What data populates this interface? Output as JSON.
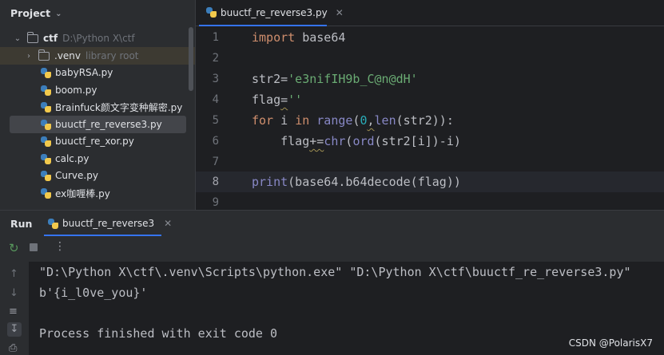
{
  "project_panel": {
    "title": "Project",
    "tree": [
      {
        "name": "ctf",
        "sub": "D:\\Python X\\ctf",
        "type": "folder"
      },
      {
        "name": ".venv",
        "sub": "library root",
        "type": "folder"
      },
      {
        "name": "babyRSA.py",
        "type": "py"
      },
      {
        "name": "boom.py",
        "type": "py"
      },
      {
        "name": "Brainfuck颜文字变种解密.py",
        "type": "py"
      },
      {
        "name": "buuctf_re_reverse3.py",
        "type": "py",
        "selected": true
      },
      {
        "name": "buuctf_re_xor.py",
        "type": "py"
      },
      {
        "name": "calc.py",
        "type": "py"
      },
      {
        "name": "Curve.py",
        "type": "py"
      },
      {
        "name": "ex咖喱棒.py",
        "type": "py"
      }
    ]
  },
  "editor": {
    "tab_label": "buuctf_re_reverse3.py",
    "line_numbers": [
      "1",
      "2",
      "3",
      "4",
      "5",
      "6",
      "7",
      "8",
      "9"
    ],
    "code": {
      "l1_kw": "import",
      "l1_rest": " base64",
      "l3_var": "str2=",
      "l3_str": "'e3nifIH9b_C@n@dH'",
      "l4_var": "flag",
      "l4_eq": "=",
      "l4_str": "''",
      "l5_for": "for",
      "l5_i": " i ",
      "l5_in": "in",
      "l5_sp": " ",
      "l5_range": "range",
      "l5_open": "(",
      "l5_zero": "0",
      "l5_comma": ",",
      "l5_len": "len",
      "l5_rest": "(str2)):",
      "l6_a": "    flag",
      "l6_op": "+=",
      "l6_chr": "chr",
      "l6_b": "(",
      "l6_ord": "ord",
      "l6_c": "(str2[i])-i)",
      "l8_print": "print",
      "l8_rest": "(base64.b64decode(flag))"
    }
  },
  "run_panel": {
    "title": "Run",
    "tab_label": "buuctf_re_reverse3",
    "console": [
      "\"D:\\Python X\\ctf\\.venv\\Scripts\\python.exe\" \"D:\\Python X\\ctf\\buuctf_re_reverse3.py\"",
      "b'{i_l0ve_you}'",
      "",
      "Process finished with exit code 0"
    ]
  },
  "watermark": "CSDN @PolarisX7",
  "colors": {
    "keyword": "#cf8e6d",
    "string": "#6aab73",
    "number": "#2aacb8",
    "builtin": "#8888c6",
    "accent": "#3574f0"
  }
}
